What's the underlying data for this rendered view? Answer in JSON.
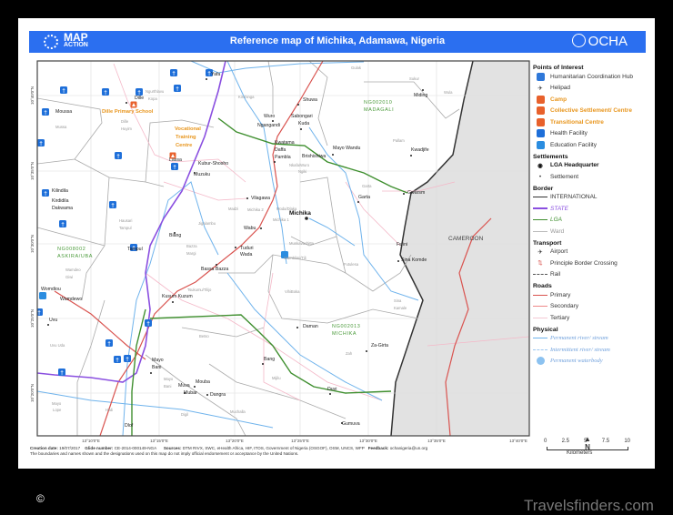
{
  "header": {
    "title": "Reference map of Michika, Adamawa, Nigeria",
    "left_logo": "MAP ACTION",
    "left_logo_top": "MAP",
    "left_logo_bottom": "ACTION",
    "right_logo": "OCHA"
  },
  "colors": {
    "header": "#2b6ff0",
    "state_border": "#8a4fe0",
    "lga_border": "#3f8f2f",
    "primary_road": "#d9534f",
    "river": "#6fb3ec",
    "poi_orange": "#e8961e",
    "health": "#1e6fd9",
    "cameroon": "#e2e2e2"
  },
  "map": {
    "lon_labels": [
      "13°10'0\"E",
      "13°15'0\"E",
      "13°20'0\"E",
      "13°25'0\"E",
      "13°30'0\"E",
      "13°35'0\"E",
      "13°40'0\"E"
    ],
    "lat_labels": [
      "10°40'0\"N",
      "10°35'0\"N",
      "10°30'0\"N",
      "10°25'0\"N",
      "10°20'0\"N"
    ],
    "places": [
      {
        "name": "Yafa",
        "type": "settlement"
      },
      {
        "name": "Ngurthlavu",
        "type": "ward"
      },
      {
        "name": "Kopa",
        "type": "ward"
      },
      {
        "name": "Kirchinga",
        "type": "ward"
      },
      {
        "name": "Wuro",
        "type": "settlement"
      },
      {
        "name": "Ngangandi",
        "type": "settlement"
      },
      {
        "name": "Shuwa",
        "type": "settlement"
      },
      {
        "name": "Sabongari",
        "type": "settlement"
      },
      {
        "name": "Kuda",
        "type": "settlement"
      },
      {
        "name": "Gulak",
        "type": "ward"
      },
      {
        "name": "Sukur",
        "type": "ward"
      },
      {
        "name": "Miding",
        "type": "settlement"
      },
      {
        "name": "Wula",
        "type": "ward"
      },
      {
        "name": "NG002010",
        "type": "lga"
      },
      {
        "name": "MADAGALI",
        "type": "lga"
      },
      {
        "name": "Dille",
        "type": "settlement"
      },
      {
        "name": "Dille Primary School",
        "type": "poi"
      },
      {
        "name": "Moussa",
        "type": "settlement"
      },
      {
        "name": "Mussa",
        "type": "ward"
      },
      {
        "name": "Dille",
        "type": "ward"
      },
      {
        "name": "Huyim",
        "type": "ward"
      },
      {
        "name": "Vocational",
        "type": "poi"
      },
      {
        "name": "Training",
        "type": "poi"
      },
      {
        "name": "Centre",
        "type": "poi"
      },
      {
        "name": "Lassa",
        "type": "settlement"
      },
      {
        "name": "Kubur-Shosho",
        "type": "settlement"
      },
      {
        "name": "Muzuku",
        "type": "settlement"
      },
      {
        "name": "Kwatama",
        "type": "settlement"
      },
      {
        "name": "Daffa",
        "type": "settlement"
      },
      {
        "name": "Pambla",
        "type": "settlement"
      },
      {
        "name": "Brishishiwa",
        "type": "settlement"
      },
      {
        "name": "Mayo Wandu",
        "type": "settlement"
      },
      {
        "name": "Nkafa/Wuro",
        "type": "ward"
      },
      {
        "name": "Ngiki",
        "type": "ward"
      },
      {
        "name": "Pallam",
        "type": "ward"
      },
      {
        "name": "Kwadjife",
        "type": "settlement"
      },
      {
        "name": "Garta",
        "type": "ward"
      },
      {
        "name": "Garta",
        "type": "settlement"
      },
      {
        "name": "Gwarsm",
        "type": "settlement"
      },
      {
        "name": "Vilagawa",
        "type": "settlement"
      },
      {
        "name": "Madzi",
        "type": "ward"
      },
      {
        "name": "Michika 2",
        "type": "ward"
      },
      {
        "name": "Moda/Dlaka",
        "type": "ward"
      },
      {
        "name": "Michika 1",
        "type": "ward"
      },
      {
        "name": "Michika",
        "type": "hq"
      },
      {
        "name": "Wabu",
        "type": "settlement"
      },
      {
        "name": "Biang",
        "type": "settlement"
      },
      {
        "name": "Jigalambu",
        "type": "ward"
      },
      {
        "name": "Hausari",
        "type": "ward"
      },
      {
        "name": "Tampul",
        "type": "ward"
      },
      {
        "name": "Kilindila",
        "type": "settlement"
      },
      {
        "name": "Kirdidila",
        "type": "settlement"
      },
      {
        "name": "Dakwama",
        "type": "settlement"
      },
      {
        "name": "Tampul",
        "type": "settlement"
      },
      {
        "name": "NG008002",
        "type": "lga"
      },
      {
        "name": "ASKIRA/UBA",
        "type": "lga"
      },
      {
        "name": "Wamdeo",
        "type": "ward"
      },
      {
        "name": "Giwi",
        "type": "ward"
      },
      {
        "name": "Bazza",
        "type": "ward"
      },
      {
        "name": "Margi",
        "type": "ward"
      },
      {
        "name": "Tuduri",
        "type": "settlement"
      },
      {
        "name": "Wada",
        "type": "settlement"
      },
      {
        "name": "Bassa Bazza",
        "type": "settlement"
      },
      {
        "name": "Munkavachitta",
        "type": "ward"
      },
      {
        "name": "Wamblimi/Tili",
        "type": "ward"
      },
      {
        "name": "Futulesa",
        "type": "ward"
      },
      {
        "name": "Fwini",
        "type": "settlement"
      },
      {
        "name": "Sina Komde",
        "type": "settlement"
      },
      {
        "name": "Womdiou",
        "type": "settlement"
      },
      {
        "name": "Wamdewo",
        "type": "settlement"
      },
      {
        "name": "Tsukumu/Tilijo",
        "type": "ward"
      },
      {
        "name": "Kusum Kuzum",
        "type": "settlement"
      },
      {
        "name": "VihiBoka",
        "type": "ward"
      },
      {
        "name": "Uvu",
        "type": "settlement"
      },
      {
        "name": "Uvu Uda",
        "type": "ward"
      },
      {
        "name": "Betso",
        "type": "ward"
      },
      {
        "name": "Sina",
        "type": "ward"
      },
      {
        "name": "Kamale",
        "type": "ward"
      },
      {
        "name": "Daman",
        "type": "settlement"
      },
      {
        "name": "NG002013",
        "type": "lga"
      },
      {
        "name": "MICHIKA",
        "type": "lga"
      },
      {
        "name": "Za-Girta",
        "type": "settlement"
      },
      {
        "name": "Zah",
        "type": "ward"
      },
      {
        "name": "Bang",
        "type": "settlement"
      },
      {
        "name": "Mijilu",
        "type": "ward"
      },
      {
        "name": "Mayo",
        "type": "settlement"
      },
      {
        "name": "Bani",
        "type": "settlement"
      },
      {
        "name": "Mayo",
        "type": "ward"
      },
      {
        "name": "Bani",
        "type": "ward"
      },
      {
        "name": "Mouba",
        "type": "settlement"
      },
      {
        "name": "Muva",
        "type": "settlement"
      },
      {
        "name": "Mubar",
        "type": "settlement"
      },
      {
        "name": "Dangra",
        "type": "settlement"
      },
      {
        "name": "Mayo",
        "type": "ward"
      },
      {
        "name": "Lope",
        "type": "ward"
      },
      {
        "name": "Hildi",
        "type": "ward"
      },
      {
        "name": "Digil",
        "type": "ward"
      },
      {
        "name": "Muchalla",
        "type": "ward"
      },
      {
        "name": "Duvi",
        "type": "settlement"
      },
      {
        "name": "Gumuva",
        "type": "settlement"
      },
      {
        "name": "Dlof",
        "type": "settlement"
      },
      {
        "name": "CAMEROON",
        "type": "country"
      }
    ]
  },
  "legend": {
    "poi_title": "Points of Interest",
    "poi": [
      {
        "label": "Humanitarian Coordination Hub",
        "icon": "coordination-hub-icon"
      },
      {
        "label": "Helipad",
        "icon": "helipad-icon"
      },
      {
        "label": "Camp",
        "icon": "camp-icon"
      },
      {
        "label": "Collective Settlement/ Centre",
        "icon": "collective-settlement-icon"
      },
      {
        "label": "Transitional Centre",
        "icon": "transitional-centre-icon"
      },
      {
        "label": "Health Facility",
        "icon": "health-facility-icon"
      },
      {
        "label": "Education Facility",
        "icon": "education-facility-icon"
      }
    ],
    "settlements_title": "Settlements",
    "lga_hq": "LGA Headquarter",
    "settlement": "Settlement",
    "border_title": "Border",
    "international": "INTERNATIONAL",
    "state": "STATE",
    "lga": "LGA",
    "ward": "Ward",
    "transport_title": "Transport",
    "airport": "Airport",
    "border_crossing": "Principle Border Crossing",
    "rail": "Rail",
    "roads_title": "Roads",
    "primary": "Primary",
    "secondary": "Secondary",
    "tertiary": "Tertiary",
    "physical_title": "Physical",
    "perm_river": "Permanent river/ stream",
    "inter_river": "Intermittent river/ stream",
    "waterbody": "Permanent waterbody"
  },
  "scale": {
    "ticks": [
      "0",
      "2.5",
      "5",
      "7.5",
      "10"
    ],
    "unit": "Kilometers",
    "north": "N"
  },
  "footer": {
    "creation_label": "Creation date:",
    "creation_value": "19/07/2017",
    "glide_label": "Glide number:",
    "glide_value": "CE-2014-000149-NGA",
    "sources_label": "Sources:",
    "sources_value": "DTM RIVX, SWC, eHealth Africa, HIF, ITOS, Government of Nigeria (OSGOF), OSM, UNCS, WFP",
    "feedback_label": "Feedback:",
    "feedback_value": "ochanigeria@un.org",
    "disclaimer": "The boundaries and names shown and the designations used on this map do not imply official endorsement or acceptance by the United Nations."
  },
  "page": {
    "copyright": "©",
    "watermark": "Travelsfinders.com"
  }
}
